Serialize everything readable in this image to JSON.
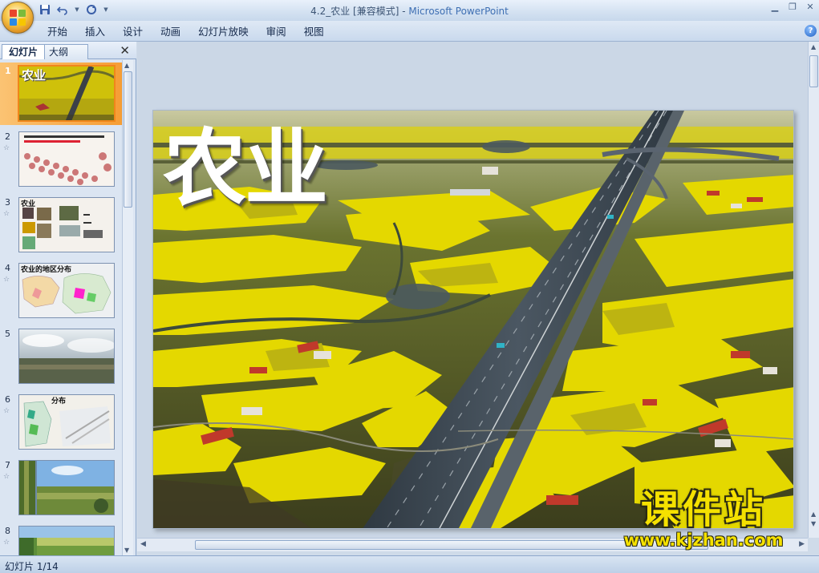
{
  "window": {
    "title": "4.2_农业 [兼容模式] - ",
    "app_name": "Microsoft PowerPoint"
  },
  "quick_access": [
    "save-icon",
    "undo-icon",
    "redo-icon",
    "customize-icon"
  ],
  "ribbon": {
    "tabs": [
      "开始",
      "插入",
      "设计",
      "动画",
      "幻灯片放映",
      "审阅",
      "视图"
    ],
    "help": "?"
  },
  "left_pane": {
    "tab_slides": "幻灯片",
    "tab_outline": "大纲",
    "close": "✕",
    "thumbnails": [
      {
        "num": "1",
        "title": "农业",
        "selected": true
      },
      {
        "num": "2",
        "title": "",
        "selected": false
      },
      {
        "num": "3",
        "title": "农业",
        "selected": false
      },
      {
        "num": "4",
        "title": "农业的地区分布",
        "selected": false
      },
      {
        "num": "5",
        "title": "",
        "selected": false
      },
      {
        "num": "6",
        "title": "分布",
        "selected": false
      },
      {
        "num": "7",
        "title": "",
        "selected": false
      },
      {
        "num": "8",
        "title": "",
        "selected": false
      }
    ]
  },
  "slide": {
    "title": "农业"
  },
  "status": {
    "slide_indicator": "幻灯片 1/14"
  },
  "watermark": {
    "brand": "课件站",
    "url": "www.kjzhan.com"
  },
  "colors": {
    "field_yellow": "#e3d400",
    "selection_orange": "#f69d35",
    "ribbon_blue": "#c9d9ed"
  }
}
